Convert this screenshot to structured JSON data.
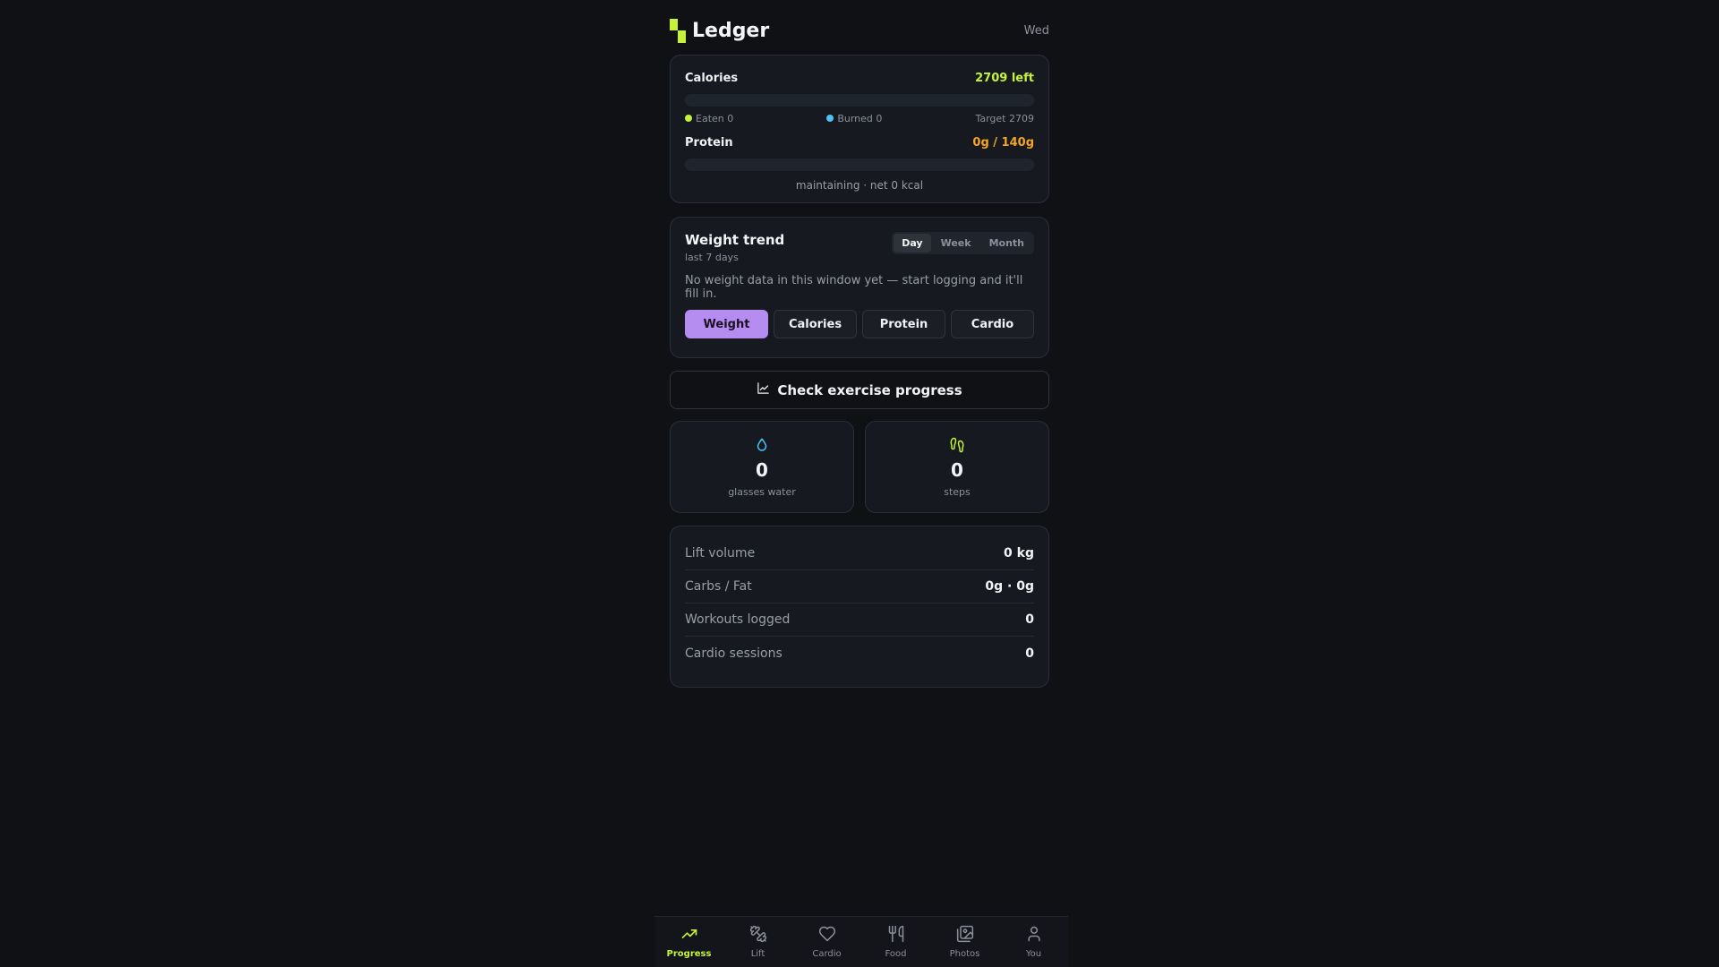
{
  "header": {
    "app_name": "Ledger",
    "day": "Wed"
  },
  "energy": {
    "calories_title": "Calories",
    "calories_left": "2709 left",
    "calories_progress": 0,
    "eaten": "Eaten 0",
    "burned": "Burned 0",
    "target": "Target 2709",
    "protein_title": "Protein",
    "protein_value": "0g / 140g",
    "protein_progress": 0,
    "status": "maintaining · net 0 kcal"
  },
  "trend": {
    "title": "Weight trend",
    "subtitle": "last 7 days",
    "ranges": [
      "Day",
      "Week",
      "Month"
    ],
    "active_range": "Day",
    "empty_message": "No weight data in this window yet — start logging and it'll fill in.",
    "metrics": [
      "Weight",
      "Calories",
      "Protein",
      "Cardio"
    ],
    "active_metric": "Weight"
  },
  "exercise_button": {
    "label": "Check exercise progress"
  },
  "stats": {
    "water_value": "0",
    "water_label": "glasses water",
    "steps_value": "0",
    "steps_label": "steps"
  },
  "summary": {
    "rows": [
      {
        "label": "Lift volume",
        "value": "0 kg"
      },
      {
        "label": "Carbs / Fat",
        "value": "0g · 0g"
      },
      {
        "label": "Workouts logged",
        "value": "0"
      },
      {
        "label": "Cardio sessions",
        "value": "0"
      }
    ]
  },
  "tabs": [
    {
      "label": "Progress",
      "icon": "trending-up-icon",
      "active": true
    },
    {
      "label": "Lift",
      "icon": "dumbbell-icon",
      "active": false
    },
    {
      "label": "Cardio",
      "icon": "heart-icon",
      "active": false
    },
    {
      "label": "Food",
      "icon": "utensils-icon",
      "active": false
    },
    {
      "label": "Photos",
      "icon": "images-icon",
      "active": false
    },
    {
      "label": "You",
      "icon": "user-icon",
      "active": false
    }
  ],
  "colors": {
    "accent": "#c6f23a",
    "protein": "#f5a524",
    "burned": "#4cc3f5",
    "trend_active": "#b58cf0"
  }
}
